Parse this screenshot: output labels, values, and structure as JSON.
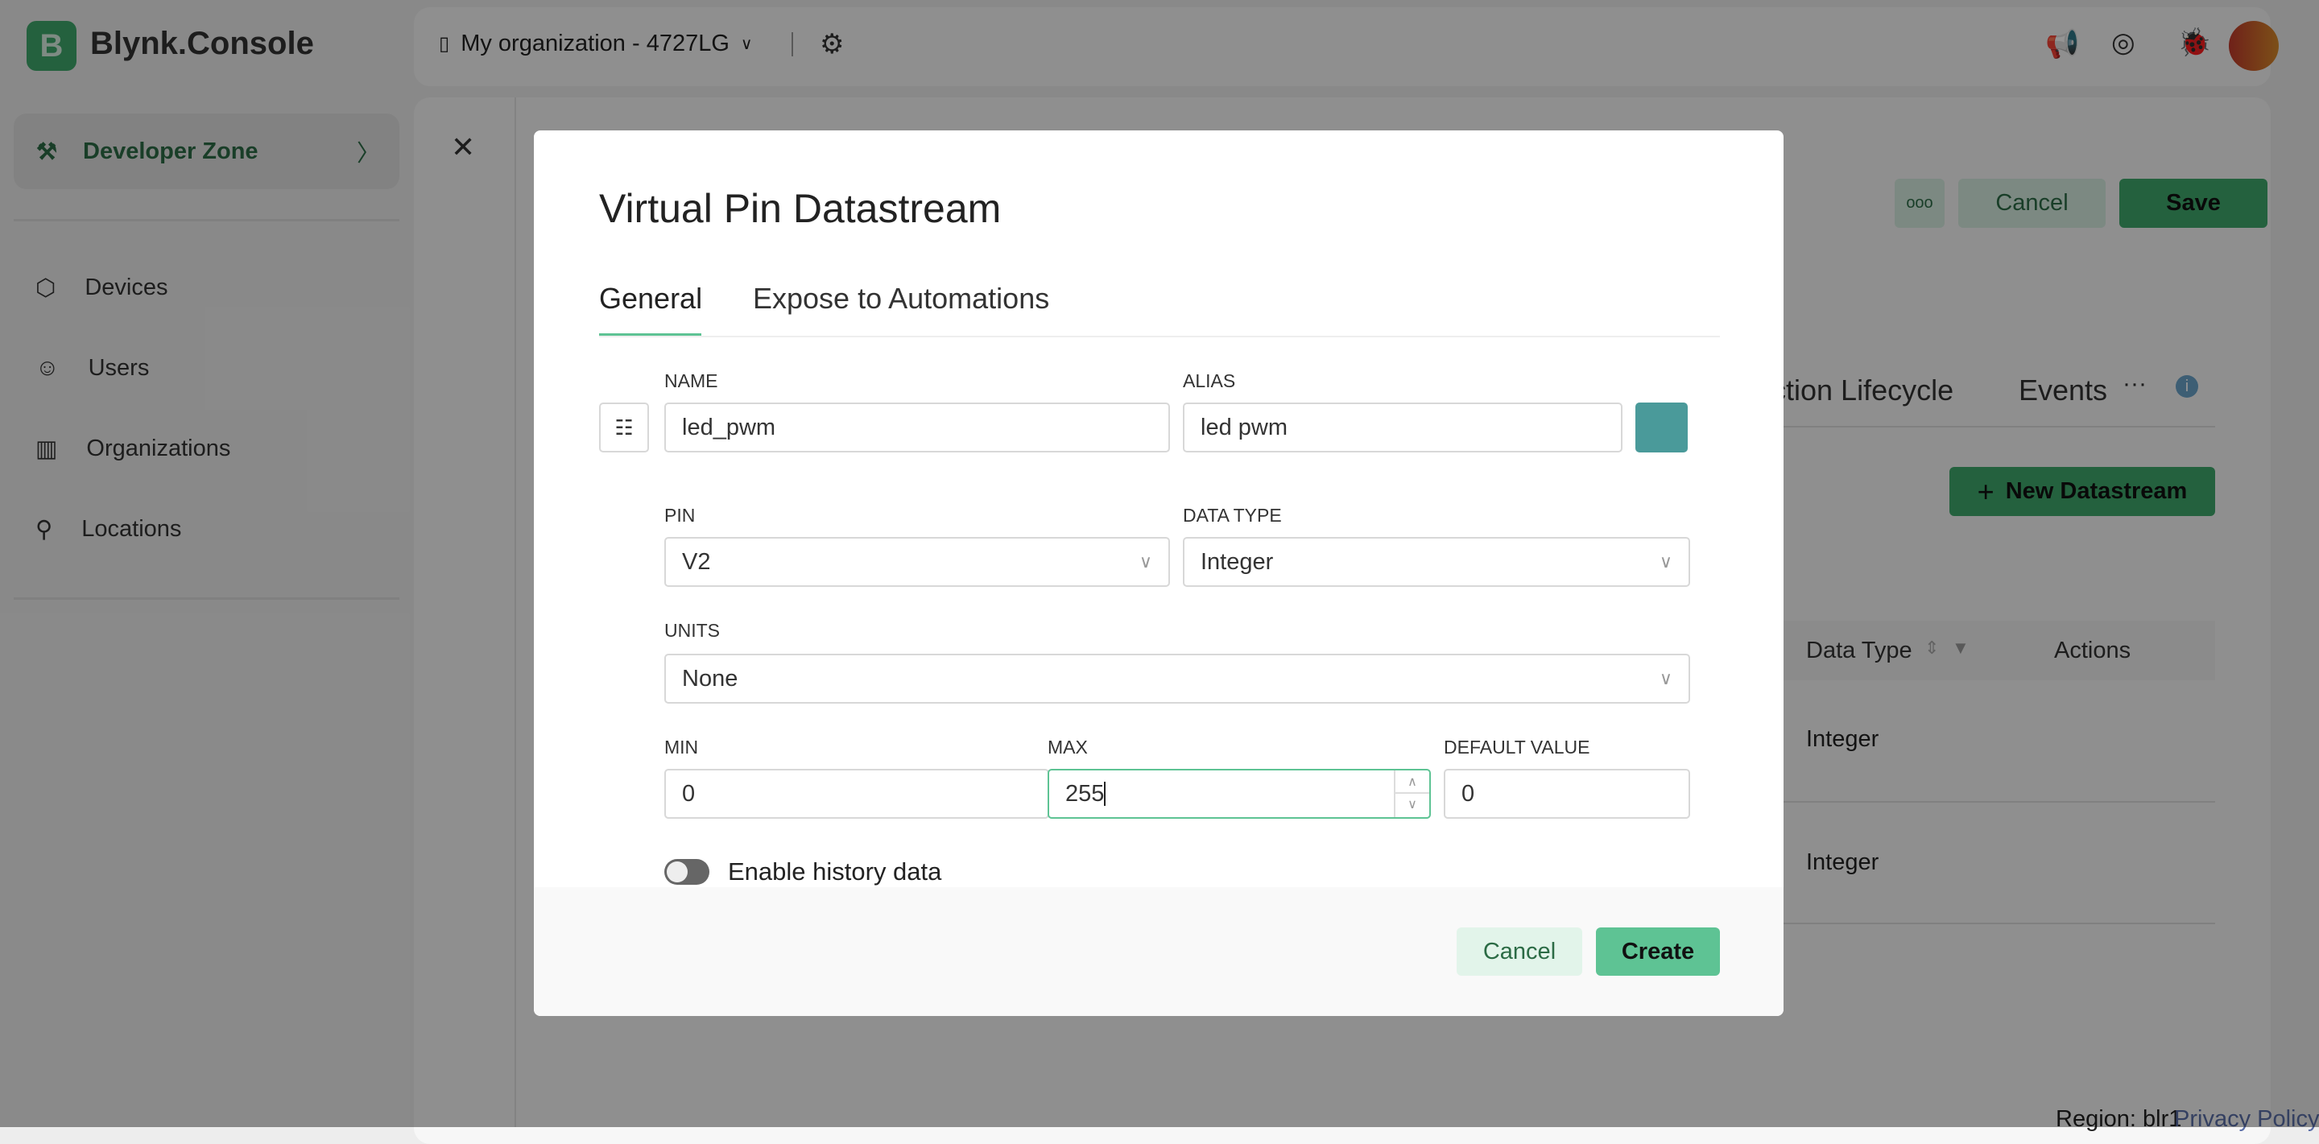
{
  "app": {
    "brand_letter": "B",
    "brand": "Blynk.Console",
    "org": "My organization - 4727LG"
  },
  "sidebar": {
    "dev_zone": "Developer Zone",
    "items": [
      {
        "label": "Devices"
      },
      {
        "label": "Users"
      },
      {
        "label": "Organizations"
      },
      {
        "label": "Locations"
      }
    ]
  },
  "page": {
    "more": "ooo",
    "cancel": "Cancel",
    "save": "Save",
    "tabs": [
      "ction Lifecycle",
      "Events"
    ],
    "tabs_more": "···",
    "new_datastream": "New Datastream",
    "table": {
      "headers": [
        "Data Type",
        "Actions"
      ],
      "rows": [
        [
          "Integer"
        ],
        [
          "Integer"
        ]
      ]
    },
    "region": "Region: blr1",
    "privacy": "Privacy Policy"
  },
  "modal": {
    "title": "Virtual Pin Datastream",
    "tabs": [
      "General",
      "Expose to Automations"
    ],
    "name_label": "NAME",
    "name_value": "led_pwm",
    "alias_label": "ALIAS",
    "alias_value": "led pwm",
    "color": "#4a9a9a",
    "pin_label": "PIN",
    "pin_value": "V2",
    "data_type_label": "DATA TYPE",
    "data_type_value": "Integer",
    "units_label": "UNITS",
    "units_value": "None",
    "min_label": "MIN",
    "min_value": "0",
    "max_label": "MAX",
    "max_value": "255",
    "default_label": "DEFAULT VALUE",
    "default_value": "0",
    "history_label": "Enable history data",
    "history_enabled": false,
    "cancel": "Cancel",
    "create": "Create"
  },
  "colors": {
    "accent": "#5ec394",
    "brand": "#3fa86b"
  }
}
